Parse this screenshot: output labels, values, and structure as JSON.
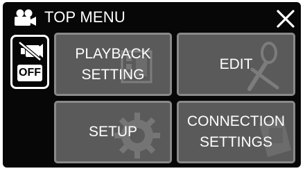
{
  "header": {
    "title": "TOP MENU",
    "camera_icon": "video-camera-icon",
    "close_icon": "close-icon"
  },
  "mute_toggle": {
    "icon": "mute-icon",
    "state_label": "OFF"
  },
  "menu": {
    "items": [
      {
        "label": "PLAYBACK\nSETTING",
        "icon": "film-icon"
      },
      {
        "label": "EDIT",
        "icon": "scissors-icon"
      },
      {
        "label": "SETUP",
        "icon": "gear-icon"
      },
      {
        "label": "CONNECTION\nSETTINGS",
        "icon": "connection-icon"
      }
    ]
  },
  "colors": {
    "background": "#070707",
    "button_fill": "#5a5a5a",
    "button_border": "#8a8a8a",
    "text": "#ffffff"
  }
}
